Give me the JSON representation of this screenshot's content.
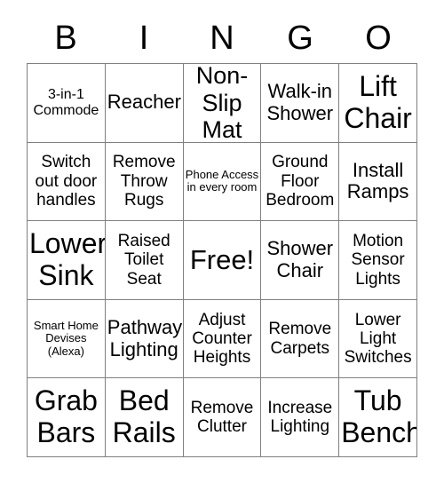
{
  "header": {
    "letters": [
      "B",
      "I",
      "N",
      "G",
      "O"
    ]
  },
  "grid": {
    "rows": [
      [
        {
          "text": "3-in-1 Commode",
          "size": "s-sm"
        },
        {
          "text": "Reacher",
          "size": "s-lg"
        },
        {
          "text": "Non-Slip Mat",
          "size": "s-xl"
        },
        {
          "text": "Walk-in Shower",
          "size": "s-lg"
        },
        {
          "text": "Lift Chair",
          "size": "s-xxl"
        }
      ],
      [
        {
          "text": "Switch out door handles",
          "size": "s-md"
        },
        {
          "text": "Remove Throw Rugs",
          "size": "s-md"
        },
        {
          "text": "Phone Access in every room",
          "size": "s-xs"
        },
        {
          "text": "Ground Floor Bedroom",
          "size": "s-md"
        },
        {
          "text": "Install Ramps",
          "size": "s-lg"
        }
      ],
      [
        {
          "text": "Lower Sink",
          "size": "s-xxl"
        },
        {
          "text": "Raised Toilet Seat",
          "size": "s-md"
        },
        {
          "text": "Free!",
          "size": "s-free"
        },
        {
          "text": "Shower Chair",
          "size": "s-lg"
        },
        {
          "text": "Motion Sensor Lights",
          "size": "s-md"
        }
      ],
      [
        {
          "text": "Smart Home Devises (Alexa)",
          "size": "s-xs"
        },
        {
          "text": "Pathway Lighting",
          "size": "s-lg"
        },
        {
          "text": "Adjust Counter Heights",
          "size": "s-md"
        },
        {
          "text": "Remove Carpets",
          "size": "s-md"
        },
        {
          "text": "Lower Light Switches",
          "size": "s-md"
        }
      ],
      [
        {
          "text": "Grab Bars",
          "size": "s-xxl"
        },
        {
          "text": "Bed Rails",
          "size": "s-xxl"
        },
        {
          "text": "Remove Clutter",
          "size": "s-md"
        },
        {
          "text": "Increase Lighting",
          "size": "s-md"
        },
        {
          "text": "Tub Bench",
          "size": "s-xxl"
        }
      ]
    ]
  },
  "colors": {
    "background": "#ffffff",
    "text": "#000000",
    "border": "#808080"
  }
}
